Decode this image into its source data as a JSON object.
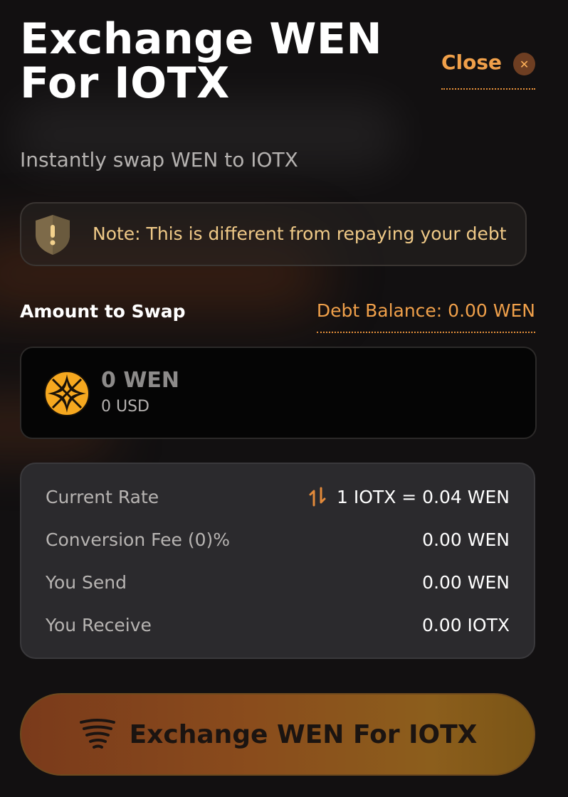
{
  "header": {
    "title": "Exchange WEN For IOTX",
    "close_label": "Close",
    "close_icon": "close-icon"
  },
  "subtitle": "Instantly swap WEN to IOTX",
  "note": {
    "icon": "shield-warning-icon",
    "text": "Note: This is different from repaying your debt"
  },
  "amount": {
    "label": "Amount to Swap",
    "debt_balance": "Debt Balance: 0.00 WEN",
    "token_icon": "wen-token-icon",
    "value": "0 WEN",
    "usd": "0 USD"
  },
  "details": {
    "rows": [
      {
        "label": "Current Rate",
        "value": "1 IOTX = 0.04 WEN",
        "icon": "swap-arrows-icon"
      },
      {
        "label": "Conversion Fee (0)%",
        "value": "0.00 WEN"
      },
      {
        "label": "You Send",
        "value": "0.00 WEN"
      },
      {
        "label": "You Receive",
        "value": "0.00 IOTX"
      }
    ]
  },
  "cta": {
    "label": "Exchange WEN For IOTX",
    "icon": "tornado-icon"
  },
  "colors": {
    "accent": "#f0a04a",
    "note_text": "#efc987",
    "background": "#121011",
    "panel": "#2b2a2d"
  }
}
